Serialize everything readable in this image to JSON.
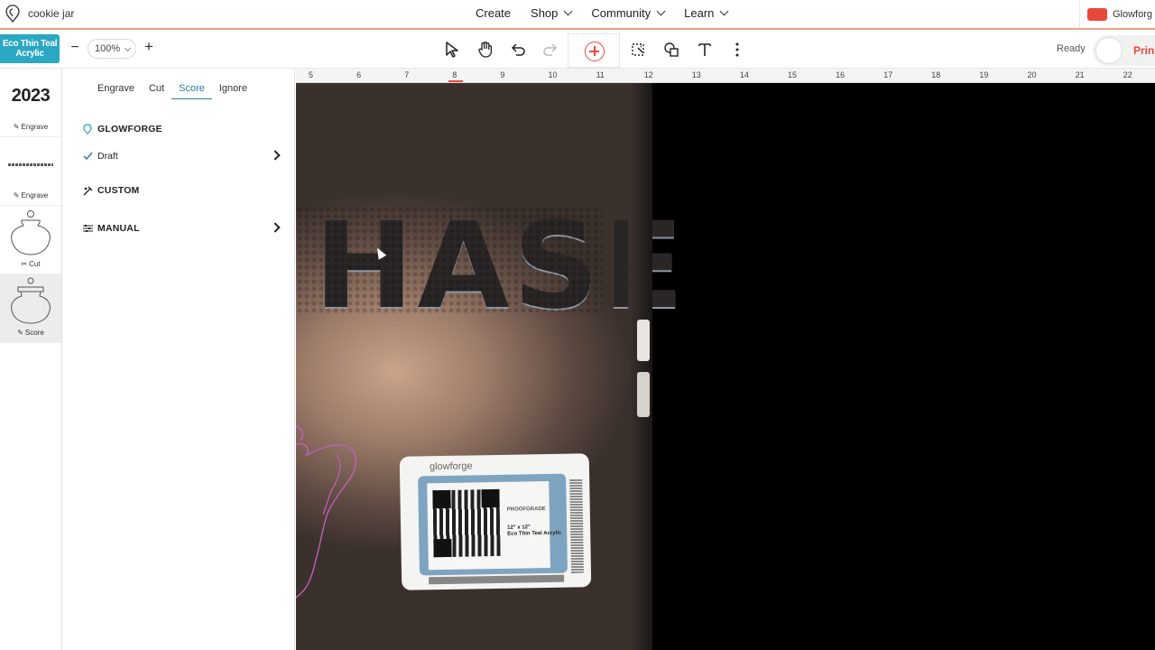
{
  "topnav": {
    "file_title": "cookie jar",
    "nav": [
      {
        "label": "Create",
        "has_menu": false
      },
      {
        "label": "Shop",
        "has_menu": true
      },
      {
        "label": "Community",
        "has_menu": true
      },
      {
        "label": "Learn",
        "has_menu": true
      }
    ],
    "account_label": "Glowforg"
  },
  "toolbar": {
    "material_name": "Eco Thin Teal Acrylic",
    "zoom_value": "100%",
    "status": "Ready",
    "print_label": "Prin"
  },
  "thumbs": [
    {
      "art": "2023",
      "caption": "Engrave",
      "icon": "pencil-icon"
    },
    {
      "art": "",
      "caption": "Engrave",
      "icon": "pencil-icon"
    },
    {
      "art": "",
      "caption": "Cut",
      "icon": "scissors-icon"
    },
    {
      "art": "",
      "caption": "Score",
      "icon": "pencil-icon"
    }
  ],
  "panel": {
    "tabs": [
      "Engrave",
      "Cut",
      "Score",
      "Ignore"
    ],
    "active_tab": "Score",
    "glowforge_label": "GLOWFORGE",
    "draft_label": "Draft",
    "custom_label": "CUSTOM",
    "manual_label": "MANUAL"
  },
  "ruler": {
    "ticks": [
      "5",
      "6",
      "7",
      "8",
      "9",
      "10",
      "11",
      "12",
      "13",
      "14",
      "15",
      "16",
      "17",
      "18",
      "19",
      "20",
      "21",
      "22"
    ]
  },
  "canvas": {
    "engraved_text": "HASE",
    "label_brand": "glowforge",
    "label_proofgrade": "PROOFGRADE",
    "label_size": "12\" x 12\"",
    "label_material": "Eco Thin Teal Acrylic"
  },
  "colors": {
    "accent": "#e8483a",
    "material_badge": "#29a7c3",
    "tab_active": "#2a7fa6"
  }
}
